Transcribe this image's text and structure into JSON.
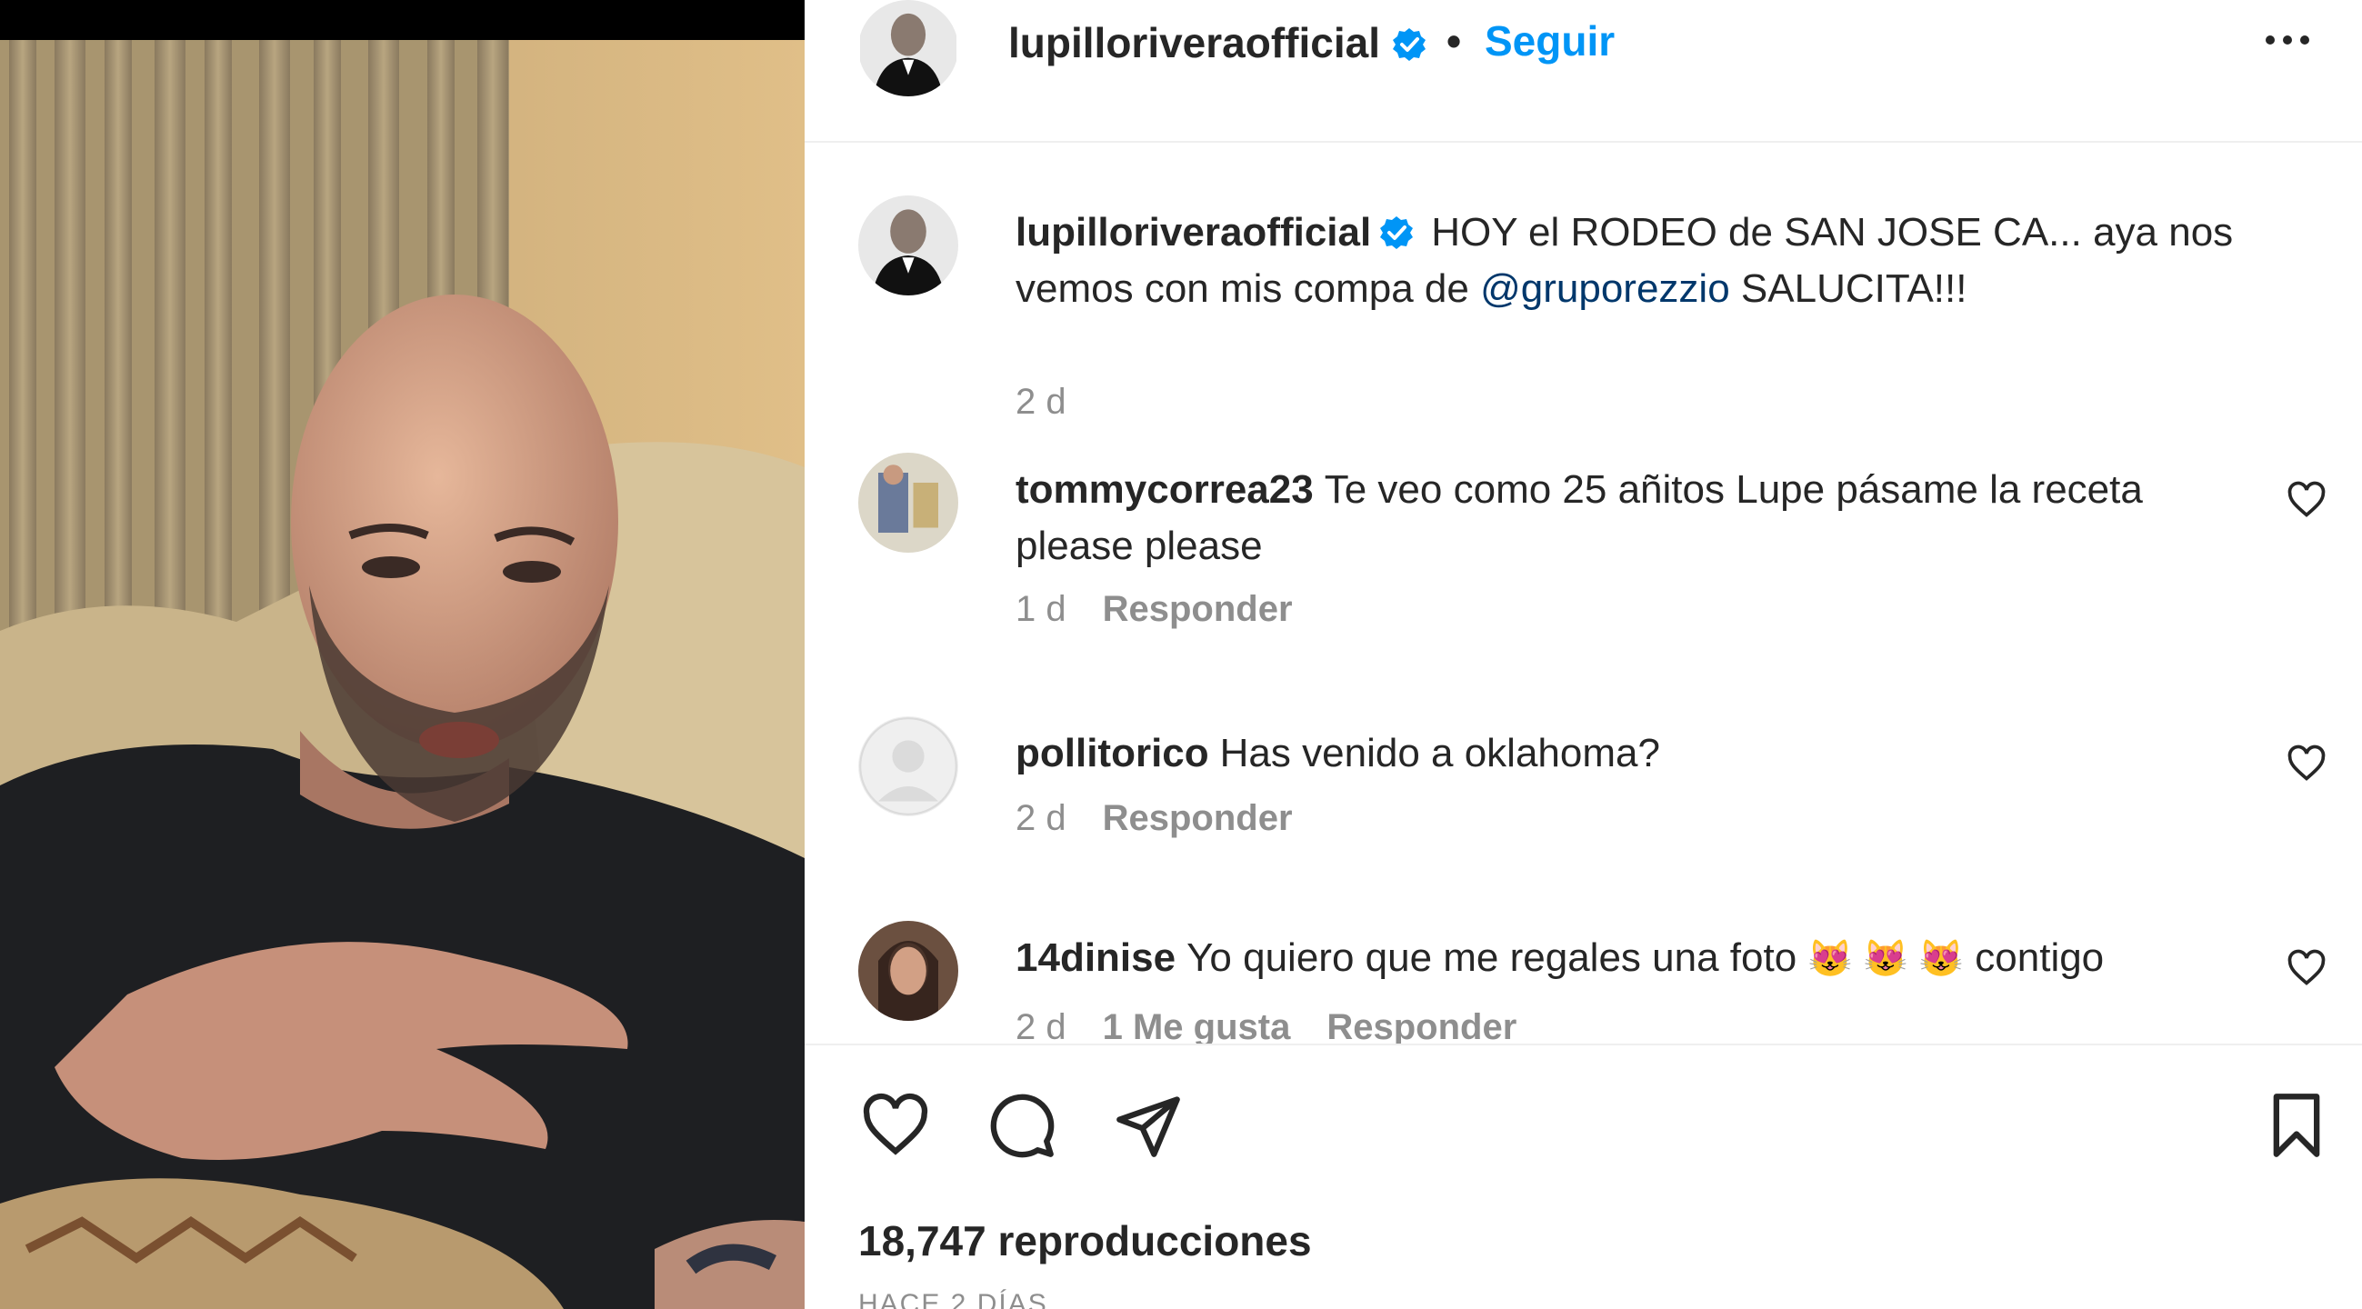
{
  "header": {
    "username": "lupilloriveraofficial",
    "separator": "•",
    "follow_label": "Seguir"
  },
  "caption": {
    "username": "lupilloriveraofficial",
    "text_before_mention": "HOY el RODEO de SAN JOSE CA... aya nos vemos con mis compa de ",
    "mention": "@gruporezzio",
    "text_after_mention": " SALUCITA!!!",
    "time": "2 d"
  },
  "comments": [
    {
      "username": "tommycorrea23",
      "text": "Te veo como 25 añitos Lupe pásame la receta please please",
      "time": "1 d",
      "reply_label": "Responder"
    },
    {
      "username": "pollitorico",
      "text": "Has venido a oklahoma?",
      "time": "2 d",
      "reply_label": "Responder"
    },
    {
      "username": "14dinise",
      "text_before": "Yo quiero que me regales una foto ",
      "emojis": "😻 😻 😻",
      "text_after": " contigo",
      "time": "2 d",
      "likes": "1 Me gusta",
      "reply_label": "Responder"
    }
  ],
  "stats": {
    "views": "18,747 reproducciones",
    "date_partial": "HACE 2 DÍAS"
  },
  "colors": {
    "accent": "#0095f6",
    "mention": "#00376b",
    "text": "#262626",
    "secondary": "#8e8e8e",
    "verified": "#0095f6"
  },
  "icons": {
    "verified": "verified-badge-icon",
    "more": "more-options-icon",
    "like": "heart-icon",
    "comment": "comment-icon",
    "share": "send-icon",
    "save": "bookmark-icon"
  }
}
